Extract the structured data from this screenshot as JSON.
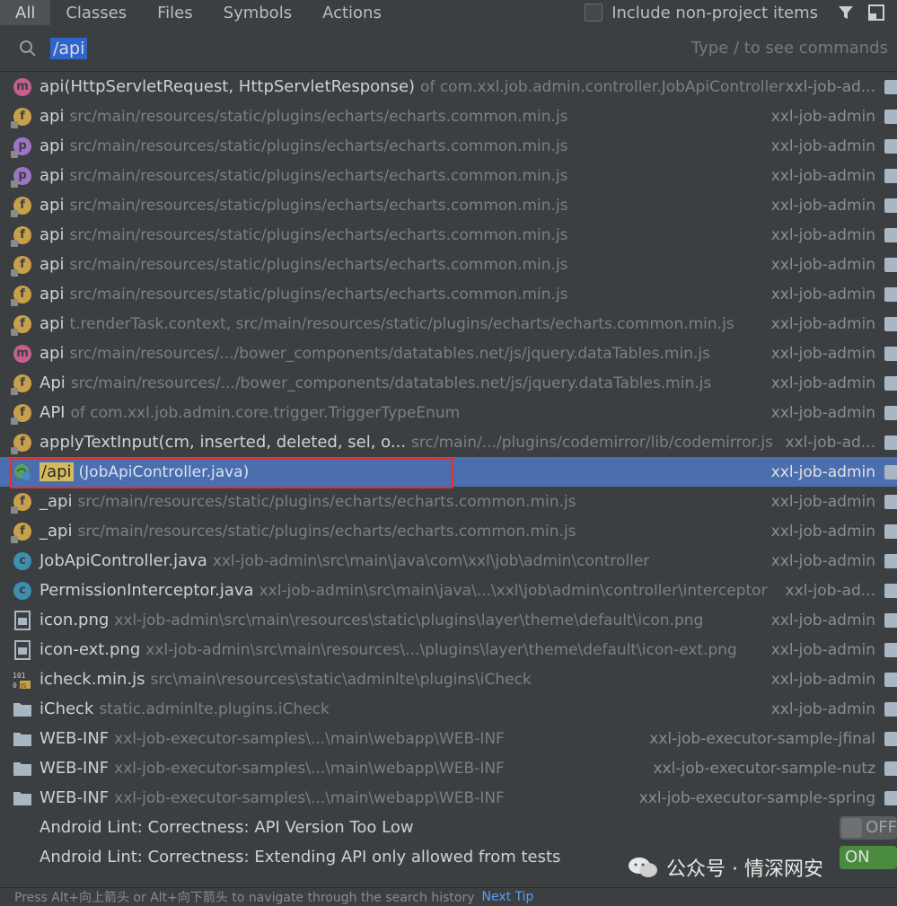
{
  "tabs": [
    {
      "label": "All",
      "active": true
    },
    {
      "label": "Classes",
      "active": false
    },
    {
      "label": "Files",
      "active": false
    },
    {
      "label": "Symbols",
      "active": false
    },
    {
      "label": "Actions",
      "active": false
    }
  ],
  "include_label": "Include non-project items",
  "search": {
    "query": "/api",
    "hint": "Type / to see commands"
  },
  "results": [
    {
      "icon": "m",
      "name": "api(HttpServletRequest, HttpServletResponse)",
      "loc": "of com.xxl.job.admin.controller.JobApiController",
      "module": "xxl-job-ad..."
    },
    {
      "icon": "f",
      "name": "api",
      "loc": "src/main/resources/static/plugins/echarts/echarts.common.min.js",
      "module": "xxl-job-admin"
    },
    {
      "icon": "p",
      "name": "api",
      "loc": "src/main/resources/static/plugins/echarts/echarts.common.min.js",
      "module": "xxl-job-admin"
    },
    {
      "icon": "p",
      "name": "api",
      "loc": "src/main/resources/static/plugins/echarts/echarts.common.min.js",
      "module": "xxl-job-admin"
    },
    {
      "icon": "f",
      "name": "api",
      "loc": "src/main/resources/static/plugins/echarts/echarts.common.min.js",
      "module": "xxl-job-admin"
    },
    {
      "icon": "f",
      "name": "api",
      "loc": "src/main/resources/static/plugins/echarts/echarts.common.min.js",
      "module": "xxl-job-admin"
    },
    {
      "icon": "f",
      "name": "api",
      "loc": "src/main/resources/static/plugins/echarts/echarts.common.min.js",
      "module": "xxl-job-admin"
    },
    {
      "icon": "f",
      "name": "api",
      "loc": "src/main/resources/static/plugins/echarts/echarts.common.min.js",
      "module": "xxl-job-admin"
    },
    {
      "icon": "f",
      "name": "api",
      "loc": "t.renderTask.context, src/main/resources/static/plugins/echarts/echarts.common.min.js",
      "module": "xxl-job-admin"
    },
    {
      "icon": "m",
      "name": "api",
      "loc": "src/main/resources/.../bower_components/datatables.net/js/jquery.dataTables.min.js",
      "module": "xxl-job-admin"
    },
    {
      "icon": "f",
      "name": "Api",
      "loc": "src/main/resources/.../bower_components/datatables.net/js/jquery.dataTables.min.js",
      "module": "xxl-job-admin"
    },
    {
      "icon": "f",
      "name": "API",
      "loc": "of com.xxl.job.admin.core.trigger.TriggerTypeEnum",
      "module": "xxl-job-admin"
    },
    {
      "icon": "f",
      "name": "applyTextInput(cm, inserted, deleted, sel, o...",
      "loc": "src/main/.../plugins/codemirror/lib/codemirror.js",
      "module": "xxl-job-ad..."
    },
    {
      "icon": "web",
      "name": "/api",
      "loc": "(JobApiController.java)",
      "module": "xxl-job-admin",
      "selected": true
    },
    {
      "icon": "f",
      "name": "_api",
      "loc": "src/main/resources/static/plugins/echarts/echarts.common.min.js",
      "module": "xxl-job-admin"
    },
    {
      "icon": "f",
      "name": "_api",
      "loc": "src/main/resources/static/plugins/echarts/echarts.common.min.js",
      "module": "xxl-job-admin"
    },
    {
      "icon": "c",
      "name": "JobApiController.java",
      "loc": "xxl-job-admin\\src\\main\\java\\com\\xxl\\job\\admin\\controller",
      "module": "xxl-job-admin"
    },
    {
      "icon": "c",
      "name": "PermissionInterceptor.java",
      "loc": "xxl-job-admin\\src\\main\\java\\...\\xxl\\job\\admin\\controller\\interceptor",
      "module": "xxl-job-ad..."
    },
    {
      "icon": "image",
      "name": "icon.png",
      "loc": "xxl-job-admin\\src\\main\\resources\\static\\plugins\\layer\\theme\\default\\icon.png",
      "module": "xxl-job-admin"
    },
    {
      "icon": "image",
      "name": "icon-ext.png",
      "loc": "xxl-job-admin\\src\\main\\resources\\...\\plugins\\layer\\theme\\default\\icon-ext.png",
      "module": "xxl-job-admin"
    },
    {
      "icon": "js",
      "name": "icheck.min.js",
      "loc": "src\\main\\resources\\static\\adminlte\\plugins\\iCheck",
      "module": "xxl-job-admin"
    },
    {
      "icon": "folder",
      "name": "iCheck",
      "loc": "static.adminlte.plugins.iCheck",
      "module": "xxl-job-admin"
    },
    {
      "icon": "folder",
      "name": "WEB-INF",
      "loc": "xxl-job-executor-samples\\...\\main\\webapp\\WEB-INF",
      "module": "xxl-job-executor-sample-jfinal"
    },
    {
      "icon": "folder",
      "name": "WEB-INF",
      "loc": "xxl-job-executor-samples\\...\\main\\webapp\\WEB-INF",
      "module": "xxl-job-executor-sample-nutz"
    },
    {
      "icon": "folder",
      "name": "WEB-INF",
      "loc": "xxl-job-executor-samples\\...\\main\\webapp\\WEB-INF",
      "module": "xxl-job-executor-sample-spring"
    }
  ],
  "actions": [
    {
      "name": "Android Lint: Correctness: API Version Too Low",
      "toggle": "OFF"
    },
    {
      "name": "Android Lint: Correctness: Extending API only allowed from tests",
      "toggle": "ON"
    }
  ],
  "footer": {
    "text": "Press Alt+向上箭头 or Alt+向下箭头 to navigate through the search history",
    "next_tip": "Next Tip"
  },
  "watermark": "公众号 · 情深网安"
}
